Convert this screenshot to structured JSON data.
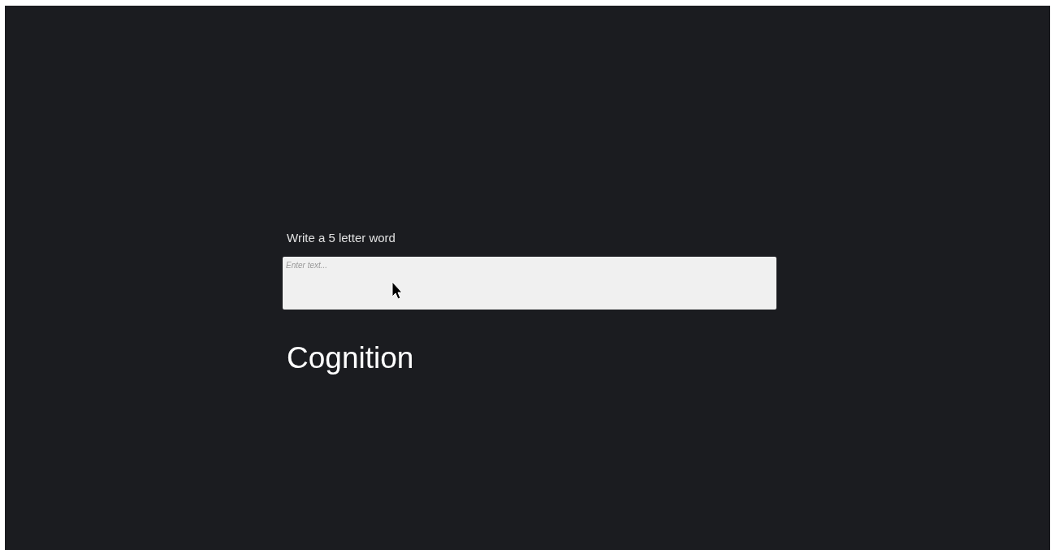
{
  "prompt": {
    "label": "Write a 5 letter word"
  },
  "text_field": {
    "placeholder": "Enter text..."
  },
  "result": {
    "text": "Cognition"
  }
}
